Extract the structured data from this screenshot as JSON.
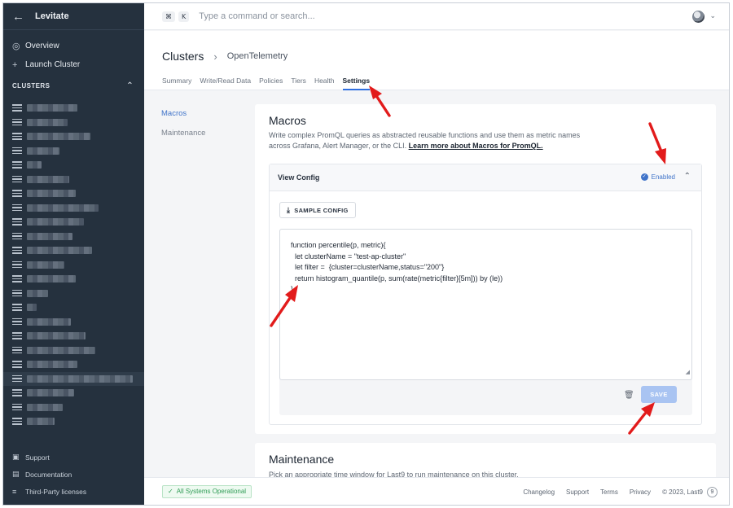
{
  "sidebar": {
    "brand": "Levitate",
    "nav": [
      {
        "label": "Overview",
        "icon": "overview-icon"
      },
      {
        "label": "Launch Cluster",
        "icon": "plus-icon"
      }
    ],
    "section_title": "CLUSTERS",
    "footer_links": [
      {
        "label": "Support",
        "icon": "chat-icon"
      },
      {
        "label": "Documentation",
        "icon": "book-icon"
      },
      {
        "label": "Third-Party licenses",
        "icon": "list-icon"
      }
    ]
  },
  "topbar": {
    "shortcut_keys": [
      "⌘",
      "K"
    ],
    "command_placeholder": "Type a command or search..."
  },
  "header": {
    "breadcrumb_main": "Clusters",
    "breadcrumb_sub": "OpenTelemetry",
    "tabs": [
      "Summary",
      "Write/Read Data",
      "Policies",
      "Tiers",
      "Health",
      "Settings"
    ],
    "active_tab": "Settings"
  },
  "subnav": [
    "Macros",
    "Maintenance"
  ],
  "macros": {
    "title": "Macros",
    "description": "Write complex PromQL queries as abstracted reusable functions and use them as metric names across Grafana, Alert Manager, or the CLI.",
    "learn_more": "Learn more about Macros for PromQL.",
    "view_config": "View Config",
    "status": "Enabled",
    "sample_config": "SAMPLE CONFIG",
    "code_lines": [
      "function percentile(p, metric){",
      "  let clusterName = \"test-ap-cluster\"",
      "  let filter =  {cluster=clusterName,status=\"200\"}",
      "  return histogram_quantile(p, sum(rate(metric{filter}[5m])) by (le))",
      "}"
    ],
    "save": "SAVE"
  },
  "maintenance": {
    "title": "Maintenance",
    "description": "Pick an appropriate time window for Last9 to run maintenance on this cluster."
  },
  "footer": {
    "status": "All Systems Operational",
    "links": [
      "Changelog",
      "Support",
      "Terms",
      "Privacy"
    ],
    "copyright": "© 2023, Last9",
    "logo_glyph": "9"
  },
  "colors": {
    "sidebar_bg": "#25313e",
    "accent": "#2f6fe0",
    "annotation_arrow": "#e21b1b",
    "success": "#2f9c55"
  }
}
